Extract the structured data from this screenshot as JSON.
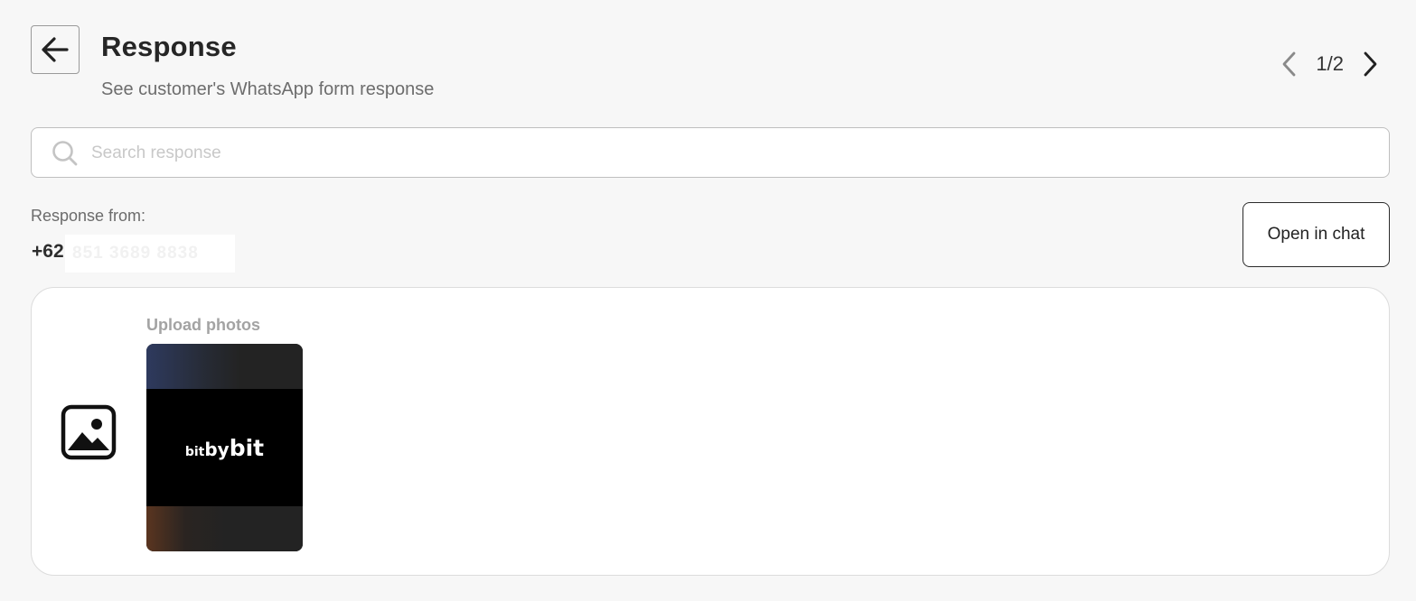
{
  "header": {
    "title": "Response",
    "subtitle": "See customer's WhatsApp form response",
    "back_icon": "arrow-left-icon"
  },
  "pagination": {
    "current": 1,
    "total": 2,
    "label": "1/2",
    "prev_icon": "chevron-left-icon",
    "next_icon": "chevron-right-icon"
  },
  "search": {
    "placeholder": "Search response",
    "value": "",
    "icon": "search-icon"
  },
  "responder": {
    "label": "Response from:",
    "phone_prefix": "+62",
    "phone_masked": "851 3689 8838"
  },
  "actions": {
    "open_in_chat": "Open in chat"
  },
  "response_items": [
    {
      "type_icon": "image-icon",
      "question": "Upload photos",
      "photo_logo": {
        "part1": "bit",
        "part2": "by",
        "part3": "bit"
      }
    }
  ],
  "colors": {
    "background": "#f7f7f7",
    "card": "#ffffff",
    "border": "#bfbfbf",
    "text": "#222222",
    "muted": "#6d6d6d"
  }
}
